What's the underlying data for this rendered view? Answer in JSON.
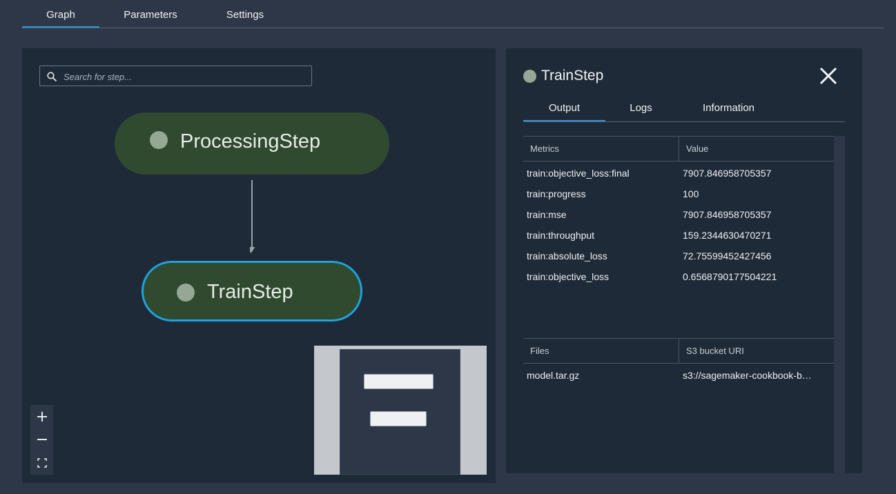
{
  "top_tabs": [
    {
      "label": "Graph",
      "active": true
    },
    {
      "label": "Parameters",
      "active": false
    },
    {
      "label": "Settings",
      "active": false
    }
  ],
  "graph": {
    "search_placeholder": "Search for step...",
    "nodes": [
      {
        "label": "ProcessingStep",
        "selected": false
      },
      {
        "label": "TrainStep",
        "selected": true
      }
    ],
    "zoom_controls": [
      "zoom-in",
      "zoom-out",
      "fit-view"
    ]
  },
  "detail": {
    "title": "TrainStep",
    "tabs": [
      {
        "label": "Output",
        "active": true
      },
      {
        "label": "Logs",
        "active": false
      },
      {
        "label": "Information",
        "active": false
      }
    ],
    "metrics": {
      "headers": [
        "Metrics",
        "Value"
      ],
      "rows": [
        [
          "train:objective_loss:final",
          "7907.846958705357"
        ],
        [
          "train:progress",
          "100"
        ],
        [
          "train:mse",
          "7907.846958705357"
        ],
        [
          "train:throughput",
          "159.2344630470271"
        ],
        [
          "train:absolute_loss",
          "72.75599452427456"
        ],
        [
          "train:objective_loss",
          "0.6568790177504221"
        ]
      ]
    },
    "files": {
      "headers": [
        "Files",
        "S3 bucket URI"
      ],
      "rows": [
        [
          "model.tar.gz",
          "s3://sagemaker-cookbook-b…"
        ]
      ]
    }
  },
  "colors": {
    "background": "#2d3748",
    "panel": "#1f2a38",
    "node_fill": "#2f4a2f",
    "node_dot": "#94a894",
    "selected_border": "#1fa2dd",
    "tab_underline": "#2f96d4"
  }
}
